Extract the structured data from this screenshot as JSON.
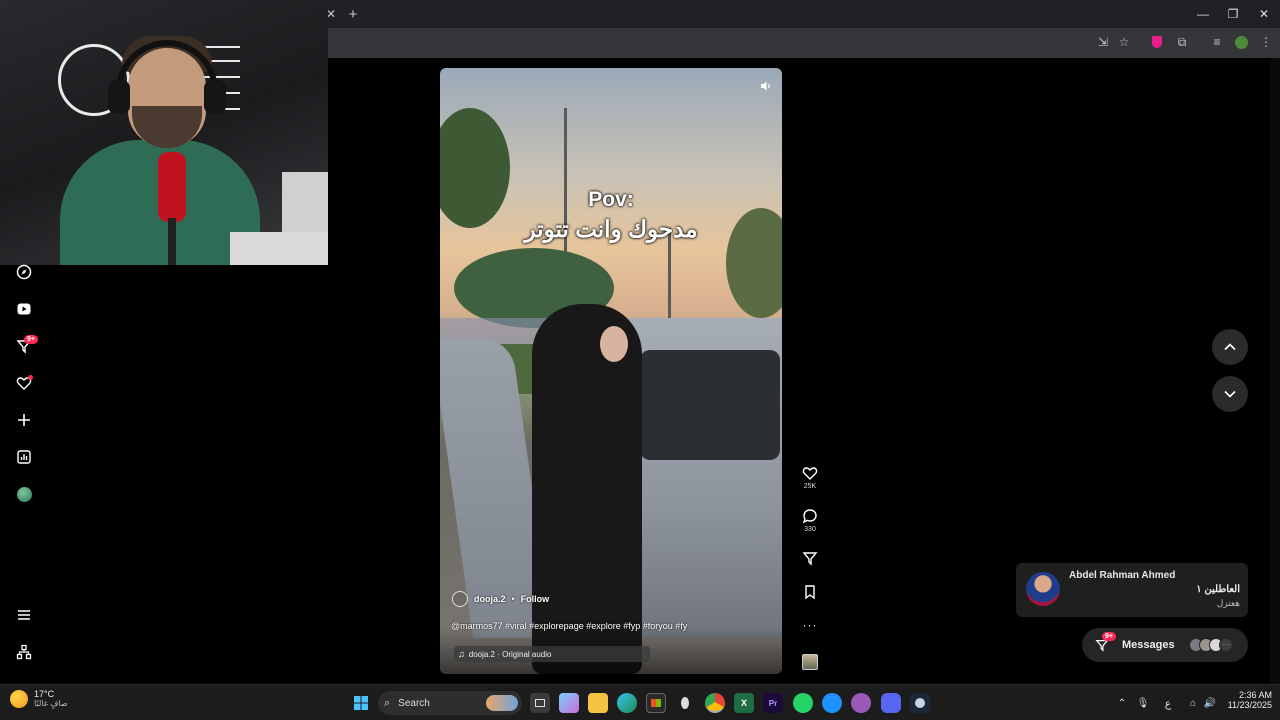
{
  "browser": {
    "new_tab_icon": "plus-icon",
    "close_tab_icon": "close-icon",
    "window_controls": [
      "minimize-icon",
      "restore-icon",
      "close-icon"
    ],
    "toolbar_icons": [
      "install-icon",
      "star-icon",
      "extension-shield-icon",
      "puzzle-icon",
      "media-icon",
      "profile-icon",
      "menu-icon"
    ]
  },
  "sidebar": {
    "items": [
      {
        "icon": "compass-icon"
      },
      {
        "icon": "live-icon"
      },
      {
        "icon": "inbox-icon",
        "badge": "9+"
      },
      {
        "icon": "heart-icon"
      },
      {
        "icon": "upload-icon"
      },
      {
        "icon": "analytics-icon"
      },
      {
        "icon": "avatar-icon"
      }
    ],
    "menu_icon": "hamburger-icon",
    "more_icon": "apps-icon"
  },
  "video": {
    "caption_line1": "Pov:",
    "caption_line2": "مدحوك وانت تتوتر",
    "username": "dooja.2",
    "separator": "•",
    "follow_label": "Follow",
    "hashtags": "@marmos77 #viral #explorepage #explore #fyp #foryou #fy",
    "audio": "dooja.2 · Original audio",
    "mute_icon": "speaker-icon"
  },
  "actions": {
    "likes": "25K",
    "comments": "330"
  },
  "notification": {
    "sender": "Abdel Rahman Ahmed",
    "message_title": "العاطلين ١",
    "message_sub": "هعتزل"
  },
  "messages": {
    "label": "Messages",
    "badge": "9+"
  },
  "taskbar": {
    "weather_temp": "17°C",
    "weather_desc": "صافٍ غالبًا",
    "search_label": "Search",
    "lang": "ع",
    "time": "2:36 AM",
    "date": "11/23/2025"
  }
}
